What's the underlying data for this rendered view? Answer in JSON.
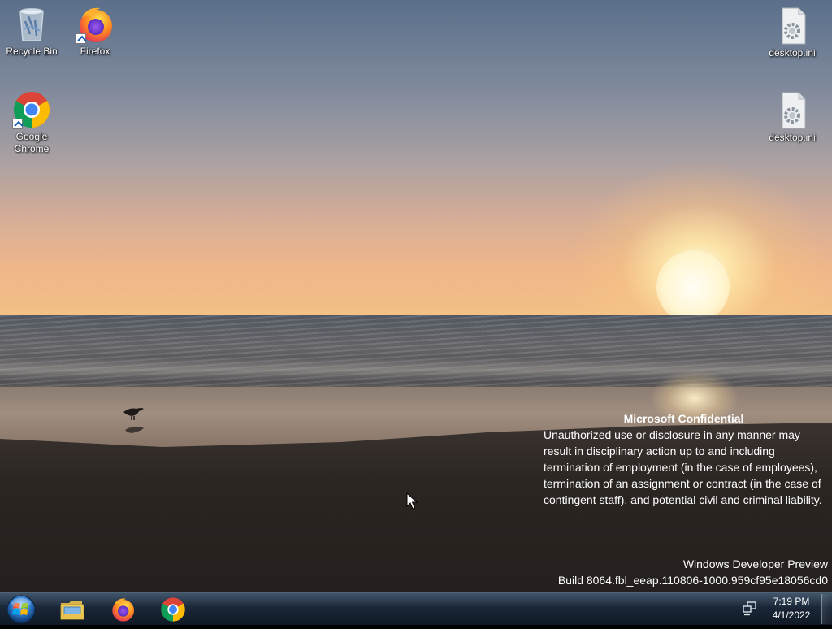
{
  "desktop": {
    "icons": [
      {
        "label": "Recycle Bin",
        "icon": "recycle-bin-icon"
      },
      {
        "label": "Firefox",
        "icon": "firefox-icon"
      },
      {
        "label": "Google Chrome",
        "icon": "chrome-icon"
      },
      {
        "label": "desktop.ini",
        "icon": "settings-file-icon"
      },
      {
        "label": "desktop.ini",
        "icon": "settings-file-icon"
      }
    ]
  },
  "watermark": {
    "title": "Microsoft Confidential",
    "body": "Unauthorized use or disclosure in any manner may result in disciplinary action up to and including termination of employment (in the case of employees), termination of an assignment or contract (in the case of contingent staff), and potential civil and criminal liability.",
    "edition": "Windows Developer Preview",
    "build": "Build 8064.fbl_eeap.110806-1000.959cf95e18056cd0"
  },
  "taskbar": {
    "start_icon": "windows-start-orb-icon",
    "pinned": [
      {
        "name": "file-explorer",
        "icon": "folder-icon"
      },
      {
        "name": "firefox",
        "icon": "firefox-icon"
      },
      {
        "name": "chrome",
        "icon": "chrome-icon"
      }
    ],
    "tray": {
      "network_icon": "network-icon",
      "time": "7:19 PM",
      "date": "4/1/2022"
    }
  },
  "colors": {
    "taskbar": "#1a2a3c",
    "sky_top": "#5b6f8a",
    "sunset": "#f4c186"
  }
}
